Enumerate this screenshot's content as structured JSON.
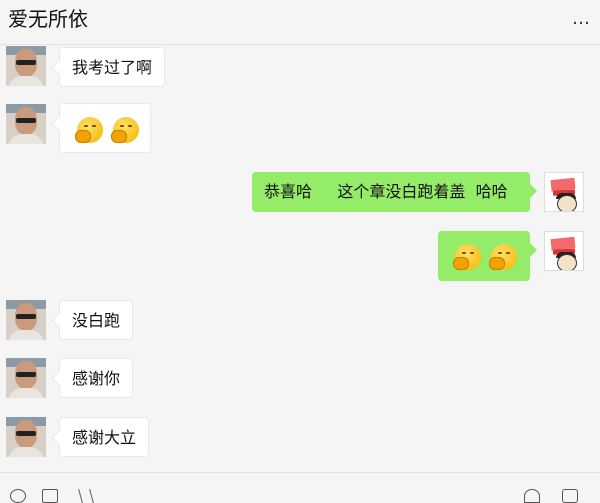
{
  "header": {
    "title": "爱无所依",
    "more_icon": "…"
  },
  "messages": [
    {
      "side": "left",
      "text": "我考过了啊"
    },
    {
      "side": "left",
      "emoji": [
        "covering-mouth-emoji",
        "covering-mouth-emoji"
      ]
    },
    {
      "side": "right",
      "text": "恭喜哈     这个章没白跑着盖  哈哈"
    },
    {
      "side": "right",
      "emoji": [
        "covering-mouth-emoji",
        "covering-mouth-emoji"
      ]
    },
    {
      "side": "left",
      "text": "没白跑"
    },
    {
      "side": "left",
      "text": "感谢你"
    },
    {
      "side": "left",
      "text": "感谢大立"
    }
  ],
  "toolbar": {
    "icons": [
      "emoji-icon",
      "folder-icon",
      "scissors-icon",
      "voice-icon",
      "chat-icon"
    ]
  },
  "colors": {
    "background": "#f5f5f5",
    "bubble_right": "#95ec69",
    "bubble_left": "#ffffff"
  }
}
